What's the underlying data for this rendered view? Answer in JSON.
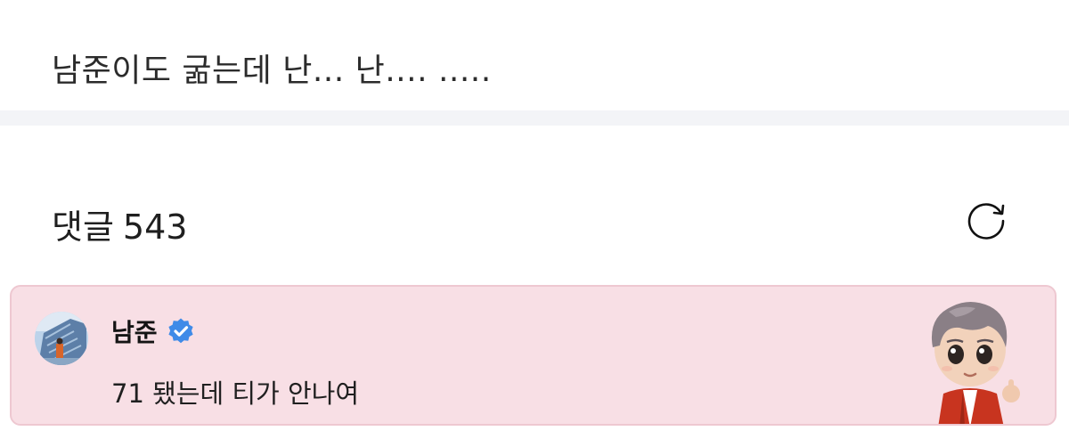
{
  "post": {
    "text": "남준이도 굶는데 난... 난.... ....."
  },
  "comments": {
    "label": "댓글",
    "count": "543",
    "refresh_icon": "refresh-icon"
  },
  "featured_comment": {
    "author": "남준",
    "verified_icon": "verified-badge-icon",
    "text": "71 됐는데 티가 안나여",
    "background": "#f8dfe5",
    "border": "#eec8d1",
    "verified_color": "#3f8be8"
  }
}
